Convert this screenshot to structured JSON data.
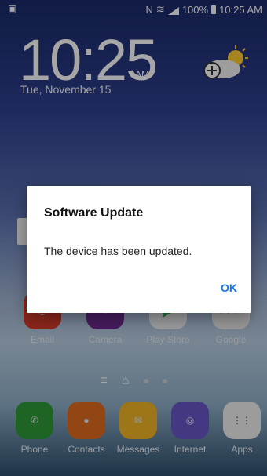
{
  "status": {
    "battery_percent": "100%",
    "time": "10:25 AM"
  },
  "lockscreen": {
    "time": "10:25",
    "ampm": "AM",
    "date": "Tue, November 15"
  },
  "dialog": {
    "title": "Software Update",
    "message": "The device has been updated.",
    "ok_label": "OK"
  },
  "home_row": [
    {
      "label": "Email",
      "color": "#d43b2b",
      "icon": "email-icon"
    },
    {
      "label": "Camera",
      "color": "#6b2a8c",
      "icon": "camera-icon"
    },
    {
      "label": "Play Store",
      "color": "#e9ecef",
      "icon": "play-store-icon"
    },
    {
      "label": "Google",
      "color": "#e6e6e6",
      "icon": "google-icon"
    }
  ],
  "dock": [
    {
      "label": "Phone",
      "color": "#2f9a3a",
      "icon": "phone-icon"
    },
    {
      "label": "Contacts",
      "color": "#e06c1f",
      "icon": "contacts-icon"
    },
    {
      "label": "Messages",
      "color": "#f0b626",
      "icon": "messages-icon"
    },
    {
      "label": "Internet",
      "color": "#6b57c9",
      "icon": "internet-icon"
    },
    {
      "label": "Apps",
      "color": "#f0f0f0",
      "icon": "apps-icon"
    }
  ]
}
